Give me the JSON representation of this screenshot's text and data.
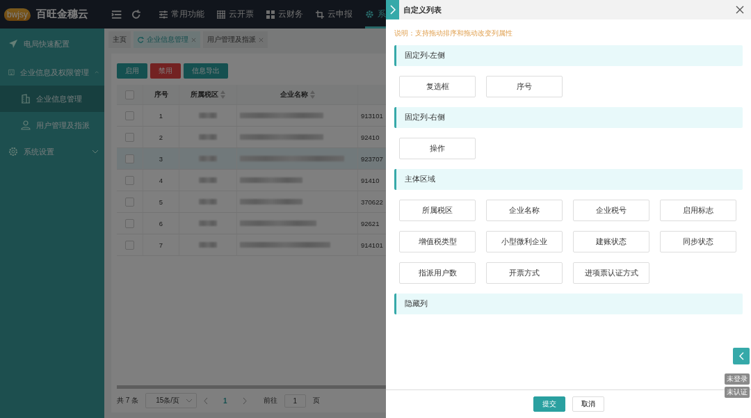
{
  "app": {
    "logo": "bwjsy",
    "title": "百旺金穗云"
  },
  "top_nav": [
    {
      "label": "常用功能",
      "selected": false
    },
    {
      "label": "云开票",
      "selected": false
    },
    {
      "label": "云财务",
      "selected": false
    },
    {
      "label": "云申报",
      "selected": false
    },
    {
      "label": "系",
      "selected": true
    }
  ],
  "sidebar": {
    "items": [
      {
        "label": "电局快速配置",
        "selected": false
      },
      {
        "label": "企业信息及权限管理",
        "expanded": true,
        "selected": false,
        "children": [
          {
            "label": "企业信息管理",
            "selected": true
          },
          {
            "label": "用户管理及指派",
            "selected": false
          }
        ]
      },
      {
        "label": "系统设置",
        "expanded": false,
        "selected": false
      }
    ]
  },
  "page_tabs": [
    {
      "label": "主页",
      "selected": false,
      "closable": false
    },
    {
      "label": "企业信息管理",
      "selected": true,
      "closable": true
    },
    {
      "label": "用户管理及指派",
      "selected": false,
      "closable": true
    }
  ],
  "toolbar": [
    {
      "label": "启用",
      "kind": "primary"
    },
    {
      "label": "禁用",
      "kind": "danger"
    },
    {
      "label": "信息导出",
      "kind": "primary"
    }
  ],
  "table": {
    "header_checked": false,
    "columns": [
      "序号",
      "所属税区",
      "企业名称"
    ],
    "rows": [
      {
        "seq": "1",
        "column_5": "913101",
        "checked": false,
        "highlighted": false
      },
      {
        "seq": "2",
        "column_5": "92410",
        "checked": false,
        "highlighted": false
      },
      {
        "seq": "3",
        "column_5": "923707",
        "checked": false,
        "highlighted": true
      },
      {
        "seq": "4",
        "column_5": "91410",
        "checked": false,
        "highlighted": false
      },
      {
        "seq": "5",
        "column_5": "370622",
        "checked": false,
        "highlighted": false
      },
      {
        "seq": "6",
        "column_5": "92621",
        "checked": false,
        "highlighted": false
      },
      {
        "seq": "7",
        "column_5": "914101",
        "checked": false,
        "highlighted": false
      }
    ]
  },
  "pagination": {
    "total": "共 7 条",
    "page_size": "15条/页",
    "current_page": "1",
    "goto_label": "前往",
    "goto_value": "1",
    "goto_suffix": "页"
  },
  "drawer": {
    "title": "自定义列表",
    "note": "说明：支持拖动排序和拖动改变列属性",
    "sections": [
      {
        "title": "固定列-左侧",
        "items": [
          "复选框",
          "序号"
        ]
      },
      {
        "title": "固定列-右侧",
        "items": [
          "操作"
        ]
      },
      {
        "title": "主体区域",
        "items": [
          "所属税区",
          "企业名称",
          "企业税号",
          "启用标志",
          "增值税类型",
          "小型微利企业",
          "建账状态",
          "同步状态",
          "指派用户数",
          "开票方式",
          "进项票认证方式"
        ]
      },
      {
        "title": "隐藏列"
      }
    ],
    "buttons": [
      {
        "label": "提交",
        "kind": "primary"
      },
      {
        "label": "取消",
        "kind": "default"
      }
    ]
  },
  "status_badges": [
    "未登录",
    "未认证"
  ]
}
